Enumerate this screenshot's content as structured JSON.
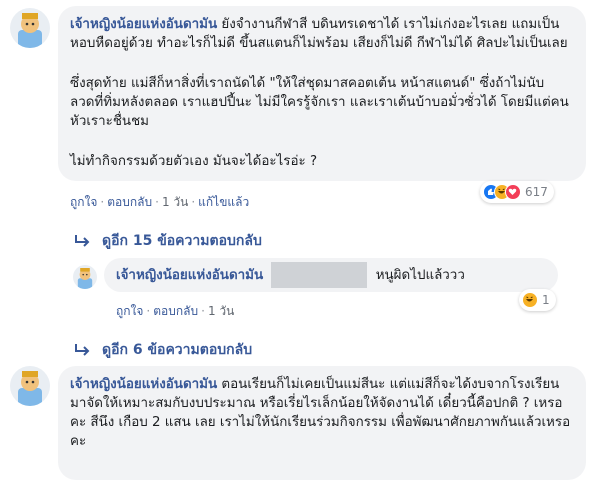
{
  "comments": [
    {
      "author": "เจ้าหญิงน้อยแห่งอันดามัน",
      "paragraph1": "ยังจำงานกีฬาสี บดินทรเดชาได้ เราไม่เก่งอะไรเลย แถมเป็นหอบหืดอยู่ด้วย ทำอะไรก็ไม่ดี ขึ้นสแตนก็ไม่พร้อม เสียงก็ไม่ดี กีฬาไม่ได้ ศิลปะไม่เป็นเลย",
      "paragraph2": "ซึ่งสุดท้าย แม่สีก็หาสิ่งที่เราถนัดได้ \"ให้ใส่ชุดมาสคอตเต้น หน้าสแตนด์\" ซึ่งถ้าไม่นับ ลวดที่ทิ่มหลังตลอด เราแฮปปี้นะ ไม่มีใครรู้จักเรา และเราเต้นบ้าบอมั่วซั่วได้ โดยมีแต่คนหัวเราะชื่นชม",
      "paragraph3": "ไม่ทำกิจกรรมด้วยตัวเอง มันจะได้อะไรอ่ะ ?",
      "actions": {
        "like": "ถูกใจ",
        "reply": "ตอบกลับ",
        "time": "1 วัน",
        "edited": "แก้ไขแล้ว"
      },
      "reaction_count": "617",
      "reaction_icons": [
        "like-icon",
        "haha-icon",
        "love-icon"
      ]
    },
    {
      "author": "เจ้าหญิงน้อยแห่งอันดามัน",
      "text": "หนูผิดไปแล้ววว",
      "actions": {
        "like": "ถูกใจ",
        "reply": "ตอบกลับ",
        "time": "1 วัน"
      },
      "reaction_count": "1",
      "reaction_icons": [
        "haha-icon"
      ]
    },
    {
      "author": "เจ้าหญิงน้อยแห่งอันดามัน",
      "text": "ตอนเรียนก็ไม่เคยเป็นแม่สีนะ แต่แม่สีก็จะได้งบจากโรงเรียนมาจัดให้เหมาะสมกับงบประมาณ หรือเรี่ยไรเล็กน้อยให้จัดงานได้ เดี๋ยวนี้คือปกติ ? เหรอคะ สีนึง เกือบ 2 แสน เลย เราไม่ให้นักเรียนร่วมกิจกรรม เพื่อพัฒนาศักยภาพกันแล้วเหรอคะ"
    }
  ],
  "more_replies": [
    {
      "label": "ดูอีก 15 ข้อความตอบกลับ"
    },
    {
      "label": "ดูอีก 6 ข้อความตอบกลับ"
    }
  ],
  "colors": {
    "link": "#385898",
    "bubble": "#f2f3f5",
    "like": "#1877f2",
    "love": "#f33e58",
    "haha": "#f7b125"
  }
}
